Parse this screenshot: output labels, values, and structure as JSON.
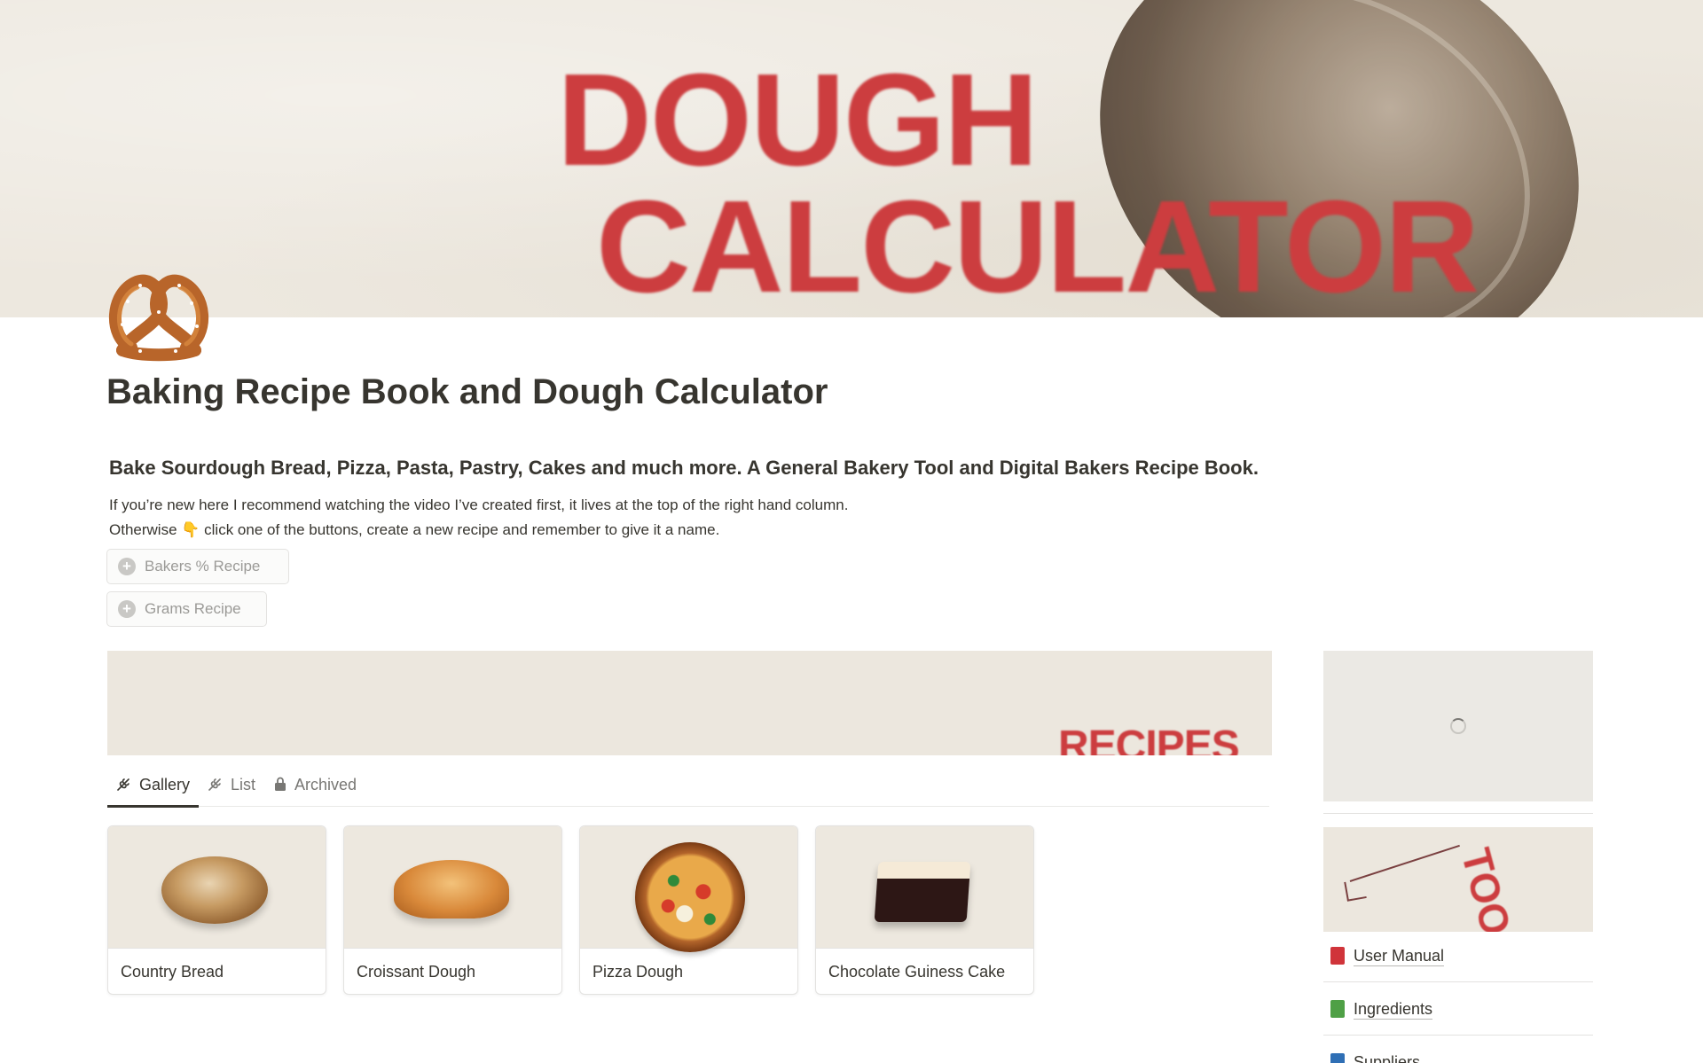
{
  "cover": {
    "line1": "DOUGH",
    "line2": "CALCULATOR",
    "text_color": "#cc3d3f"
  },
  "page": {
    "icon": "pretzel-icon",
    "title": "Baking Recipe Book and Dough Calculator",
    "subtitle": "Bake Sourdough Bread, Pizza, Pasta, Pastry, Cakes and much more. A General Bakery Tool and Digital Bakers Recipe Book.",
    "intro_line1": "If you’re new here I recommend watching the video I’ve created first, it lives at the top of the right hand column.",
    "intro_line2_before": "Otherwise ",
    "intro_emoji": "👇",
    "intro_line2_after": " click one of the buttons, create a new recipe and remember to give it a name."
  },
  "buttons": {
    "bakers": "Bakers % Recipe",
    "grams": "Grams Recipe"
  },
  "recipes_banner": {
    "text": "RECIPES"
  },
  "tabs": [
    {
      "label": "Gallery",
      "icon": "wheat-icon",
      "active": true
    },
    {
      "label": "List",
      "icon": "wheat-icon",
      "active": false
    },
    {
      "label": "Archived",
      "icon": "lock-icon",
      "active": false
    }
  ],
  "gallery": [
    {
      "title": "Country Bread",
      "image": "bread-image"
    },
    {
      "title": "Croissant Dough",
      "image": "croissant-image"
    },
    {
      "title": "Pizza Dough",
      "image": "pizza-image"
    },
    {
      "title": "Chocolate Guiness Cake",
      "image": "cake-image"
    }
  ],
  "right_column": {
    "tools_banner_text": "TOOLS",
    "links": [
      {
        "label": "User Manual",
        "icon": "red-book-icon",
        "color": "#d0343a"
      },
      {
        "label": "Ingredients",
        "icon": "green-book-icon",
        "color": "#4fa046"
      },
      {
        "label": "Suppliers",
        "icon": "blue-book-icon",
        "color": "#2f6fb5"
      }
    ]
  }
}
